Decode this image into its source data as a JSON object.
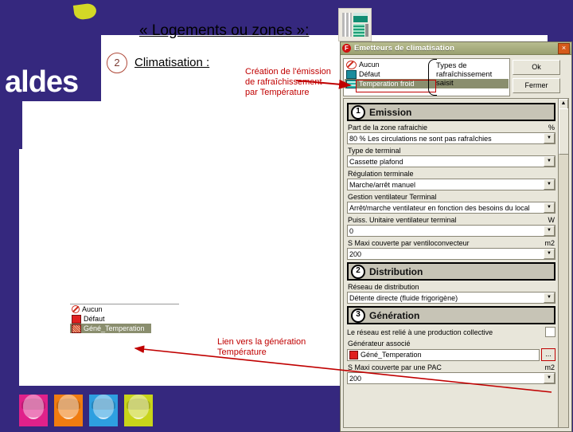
{
  "slide": {
    "title": "« Logements ou zones »:",
    "bullet_number": "2",
    "bullet_label": "Climatisation :",
    "logo_text": "aldes",
    "annotations": {
      "creation": "Création de l'émission de rafraîchissement par Température",
      "lien": "Lien vers la  génération Température",
      "types": "Types de\nrafraîchissement\nsaisit"
    }
  },
  "mini_tree": {
    "items": [
      {
        "label": "Aucun",
        "icon": "no-entry-icon",
        "selected": false
      },
      {
        "label": "Défaut",
        "icon": "red-square-icon",
        "selected": false
      },
      {
        "label": "Géné_Temperation",
        "icon": "hatched-square-icon",
        "selected": true
      }
    ]
  },
  "dialog": {
    "title": "Emetteurs de climatisation",
    "title_icon": "fr-app-icon",
    "close_label": "×",
    "list": {
      "items": [
        {
          "label": "Aucun",
          "icon": "no-entry-icon",
          "selected": false
        },
        {
          "label": "Défaut",
          "icon": "monitor-icon",
          "selected": false
        },
        {
          "label": "Temperation froid",
          "icon": "grid-icon",
          "selected": true
        }
      ]
    },
    "buttons": {
      "ok": "Ok",
      "close": "Fermer"
    },
    "sections": [
      {
        "number": "1",
        "title": "Emission",
        "fields": [
          {
            "label": "Part de la zone rafraichie",
            "unit": "%",
            "value": "80 %  Les circulations ne sont pas rafraîchies",
            "type": "combo"
          },
          {
            "label": "Type de terminal",
            "unit": "",
            "value": "Cassette plafond",
            "type": "combo"
          },
          {
            "label": "Régulation terminale",
            "unit": "",
            "value": "Marche/arrêt manuel",
            "type": "combo"
          },
          {
            "label": "Gestion ventilateur Terminal",
            "unit": "",
            "value": "Arrêt/marche ventilateur en fonction des besoins du local",
            "type": "combo"
          },
          {
            "label": "Puiss. Unitaire ventilateur terminal",
            "unit": "W",
            "value": "0",
            "type": "combo"
          },
          {
            "label": "S Maxi couverte par ventiloconvecteur",
            "unit": "m2",
            "value": "200",
            "type": "combo"
          }
        ]
      },
      {
        "number": "2",
        "title": "Distribution",
        "fields": [
          {
            "label": "Réseau de distribution",
            "unit": "",
            "value": "Détente directe (fluide frigorigène)",
            "type": "combo"
          }
        ]
      },
      {
        "number": "3",
        "title": "Génération",
        "fields": [
          {
            "label": "Le réseau est relié à une production collective",
            "unit": "",
            "value": "",
            "type": "checkbox",
            "checked": false
          },
          {
            "label": "Générateur associé",
            "unit": "",
            "value": "Géné_Temperation",
            "type": "generator",
            "browse_label": "..."
          },
          {
            "label": "S Maxi couverte par une PAC",
            "unit": "m2",
            "value": "200",
            "type": "combo"
          }
        ]
      }
    ],
    "scrollbar": {
      "up": "▲",
      "down": "▼"
    }
  },
  "photos": {
    "count": 4,
    "colors": [
      "#e0218a",
      "#f07c10",
      "#2e9fe0",
      "#c8d41a"
    ]
  }
}
